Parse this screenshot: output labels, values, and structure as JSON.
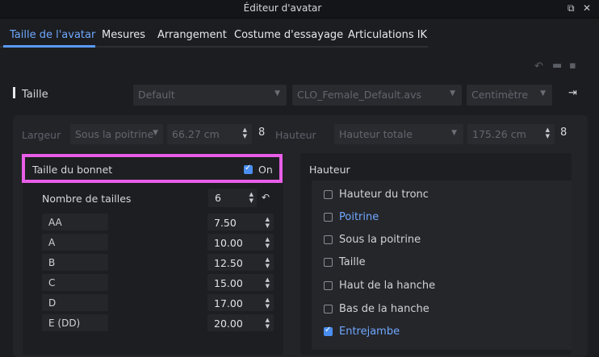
{
  "window": {
    "title": "Éditeur d'avatar"
  },
  "tabs": [
    {
      "label": "Taille de l'avatar",
      "active": true
    },
    {
      "label": "Mesures",
      "active": false
    },
    {
      "label": "Arrangement",
      "active": false
    },
    {
      "label": "Costume d'essayage",
      "active": false
    },
    {
      "label": "Articulations IK",
      "active": false
    }
  ],
  "taille_row": {
    "label": "Taille",
    "preset": "Default",
    "avatar_file": "CLO_Female_Default.avs",
    "unit": "Centimètre"
  },
  "measure_row": {
    "width_label": "Largeur",
    "width_type": "Sous la poitrine",
    "width_value": "66.27 cm",
    "height_label": "Hauteur",
    "height_type": "Hauteur totale",
    "height_value": "175.26 cm"
  },
  "cup_panel": {
    "title": "Taille du bonnet",
    "toggle_label": "On",
    "toggle_checked": true,
    "count_label": "Nombre de tailles",
    "count_value": "6",
    "sizes": [
      {
        "name": "AA",
        "value": "7.50"
      },
      {
        "name": "A",
        "value": "10.00"
      },
      {
        "name": "B",
        "value": "12.50"
      },
      {
        "name": "C",
        "value": "15.00"
      },
      {
        "name": "D",
        "value": "17.00"
      },
      {
        "name": "E (DD)",
        "value": "20.00"
      }
    ]
  },
  "height_panel": {
    "title": "Hauteur",
    "items": [
      {
        "label": "Hauteur du tronc",
        "checked": false,
        "highlight": false
      },
      {
        "label": "Poitrine",
        "checked": false,
        "highlight": true
      },
      {
        "label": "Sous la poitrine",
        "checked": false,
        "highlight": false
      },
      {
        "label": "Taille",
        "checked": false,
        "highlight": false
      },
      {
        "label": "Haut de la hanche",
        "checked": false,
        "highlight": false
      },
      {
        "label": "Bas de la hanche",
        "checked": false,
        "highlight": false
      },
      {
        "label": "Entrejambe",
        "checked": true,
        "highlight": true
      }
    ]
  },
  "colors": {
    "accent": "#5a9af7",
    "highlight_box": "#e85ee8",
    "background": "#1c1d20"
  },
  "icons": [
    "restore-window-icon",
    "close-icon",
    "undo-icon",
    "folder-open-icon",
    "save-icon",
    "export-icon",
    "link-icon",
    "reset-icon"
  ]
}
